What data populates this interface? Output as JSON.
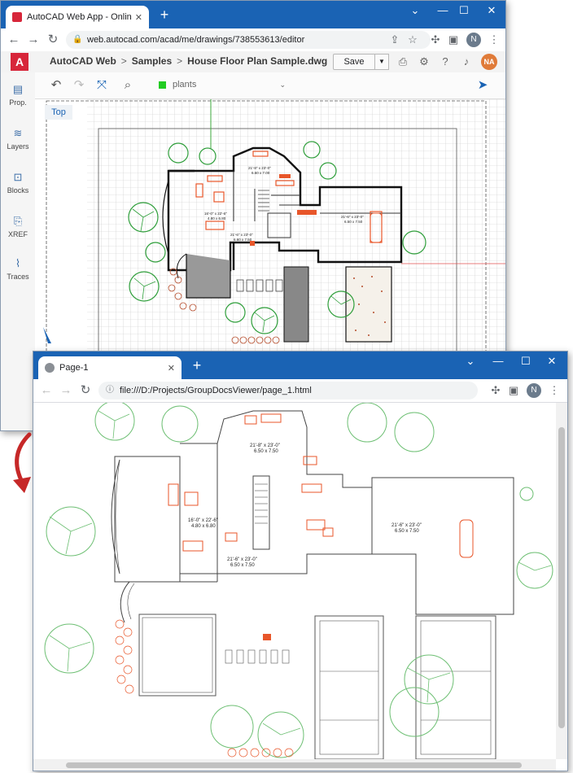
{
  "window1": {
    "tab_title": "AutoCAD Web App - Online CAD",
    "url": "web.autocad.com/acad/me/drawings/738553613/editor",
    "profile_initial": "N",
    "breadcrumb": [
      "AutoCAD Web",
      "Samples",
      "House Floor Plan Sample.dwg"
    ],
    "save_label": "Save",
    "user_initials": "NA",
    "layer_name": "plants",
    "view_label": "Top",
    "sidebar": [
      {
        "label": "Prop.",
        "icon": "properties-icon"
      },
      {
        "label": "Layers",
        "icon": "layers-icon"
      },
      {
        "label": "Blocks",
        "icon": "blocks-icon"
      },
      {
        "label": "XREF",
        "icon": "xref-icon"
      },
      {
        "label": "Traces",
        "icon": "traces-icon"
      }
    ],
    "room_labels": [
      {
        "dim": "21'-8\" x 23'-0\"",
        "metric": "6.60 x 7.00"
      },
      {
        "dim": "21'-6\" x 23'-0\"",
        "metric": "6.50 x 7.50"
      },
      {
        "dim": "16'-0\" x 22'-6\"",
        "metric": "4.80 x 6.80"
      },
      {
        "dim": "21'-6\" x 23'-0\"",
        "metric": "6.60 x 7.50"
      }
    ]
  },
  "window2": {
    "tab_title": "Page-1",
    "url": "file:///D:/Projects/GroupDocsViewer/page_1.html",
    "profile_initial": "N",
    "room_labels": [
      {
        "dim": "21'-8\" x 23'-0\"",
        "metric": "6.50 x 7.50"
      },
      {
        "dim": "16'-0\" x 22'-6\"",
        "metric": "4.80 x 6.80"
      },
      {
        "dim": "21'-6\" x 23'-0\"",
        "metric": "6.50 x 7.50"
      },
      {
        "dim": "21'-6\" x 23'-0\"",
        "metric": "6.50 x 7.50"
      }
    ]
  },
  "colors": {
    "titlebar": "#1a63b4",
    "autocad_red": "#d7263a",
    "tree_green": "#2e9e3a",
    "furniture_orange": "#e8562a",
    "layer_swatch": "#22cc22"
  }
}
